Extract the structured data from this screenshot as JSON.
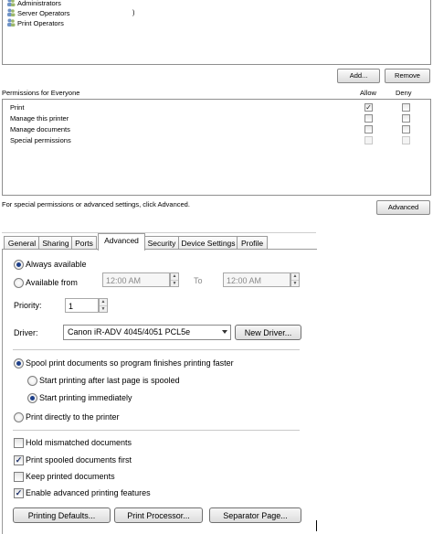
{
  "security": {
    "groups": [
      "Administrators",
      "Server Operators",
      "Print Operators"
    ],
    "stray_text": ")",
    "add_label": "Add...",
    "remove_label": "Remove",
    "permissions_for": "Permissions for Everyone",
    "allow_header": "Allow",
    "deny_header": "Deny",
    "permissions": [
      {
        "name": "Print",
        "allow": true,
        "deny": false,
        "disabled": false
      },
      {
        "name": "Manage this printer",
        "allow": false,
        "deny": false,
        "disabled": false
      },
      {
        "name": "Manage documents",
        "allow": false,
        "deny": false,
        "disabled": false
      },
      {
        "name": "Special permissions",
        "allow": false,
        "deny": false,
        "disabled": true
      }
    ],
    "advanced_hint": "For special permissions or advanced settings, click Advanced.",
    "advanced_label": "Advanced"
  },
  "tabs": [
    "General",
    "Sharing",
    "Ports",
    "Advanced",
    "Security",
    "Device Settings",
    "Profile"
  ],
  "active_tab": "Advanced",
  "advanced": {
    "always_available": "Always available",
    "available_from": "Available from",
    "from_time": "12:00 AM",
    "to_label": "To",
    "to_time": "12:00 AM",
    "priority_label": "Priority:",
    "priority_value": "1",
    "driver_label": "Driver:",
    "driver_value": "Canon iR-ADV 4045/4051 PCL5e",
    "new_driver": "New Driver...",
    "spool": "Spool print documents so program finishes printing faster",
    "start_after_last": "Start printing after last page is spooled",
    "start_immediately": "Start printing immediately",
    "print_direct": "Print directly to the printer",
    "hold_mismatched": "Hold mismatched documents",
    "print_spooled_first": "Print spooled documents first",
    "keep_printed": "Keep printed documents",
    "enable_advanced": "Enable advanced printing features",
    "printing_defaults": "Printing Defaults...",
    "print_processor": "Print Processor...",
    "separator_page": "Separator Page...",
    "checks": {
      "hold_mismatched": false,
      "print_spooled_first": true,
      "keep_printed": false,
      "enable_advanced": true
    },
    "radios": {
      "availability": "always",
      "spool_mode": "spool",
      "start_mode": "immediately"
    }
  },
  "check_glyph": "✓"
}
